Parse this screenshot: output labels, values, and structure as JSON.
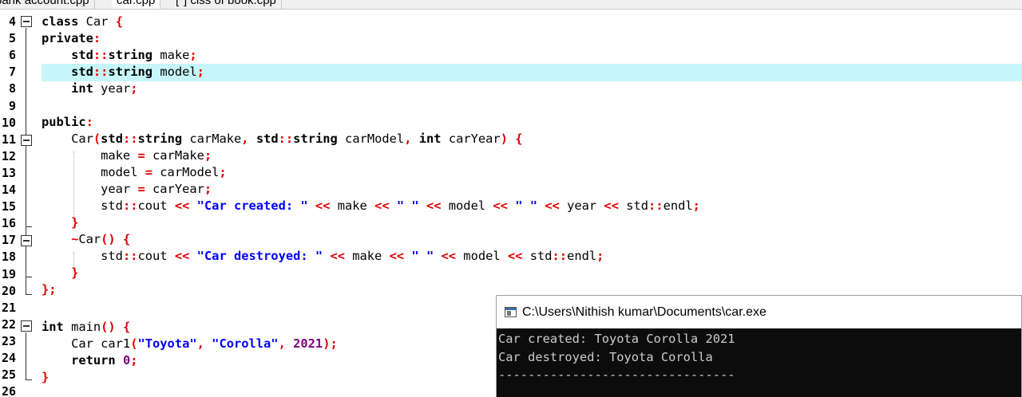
{
  "tabs": [
    "bank account.cpp",
    "car.cpp",
    "[*] clss of book.cpp"
  ],
  "line_numbers": [
    "4",
    "5",
    "6",
    "7",
    "8",
    "9",
    "10",
    "11",
    "12",
    "13",
    "14",
    "15",
    "16",
    "17",
    "18",
    "19",
    "20",
    "21",
    "22",
    "23",
    "24",
    "25",
    "26"
  ],
  "code": {
    "l4_kw": "class",
    "l4_id": " Car ",
    "l4_sy": "{",
    "l5_kw": "private",
    "l5_sy": ":",
    "l6_pre": "    ",
    "l6_a": "std",
    "l6_b": "::",
    "l6_c": "string",
    "l6_d": " make",
    "l6_e": ";",
    "l7_pre": "    ",
    "l7_a": "std",
    "l7_b": "::",
    "l7_c": "string",
    "l7_d": " model",
    "l7_e": ";",
    "l8_pre": "    ",
    "l8_kw": "int",
    "l8_id": " year",
    "l8_sy": ";",
    "l10_kw": "public",
    "l10_sy": ":",
    "l11_a": "    Car",
    "l11_b": "(",
    "l11_c": "std",
    "l11_d": "::",
    "l11_e": "string",
    "l11_f": " carMake",
    "l11_g": ", ",
    "l11_h": "std",
    "l11_i": "::",
    "l11_j": "string",
    "l11_k": " carModel",
    "l11_l": ", ",
    "l11_m": "int",
    "l11_n": " carYear",
    "l11_o": ") {",
    "l12_a": "        make ",
    "l12_b": "=",
    "l12_c": " carMake",
    "l12_d": ";",
    "l13_a": "        model ",
    "l13_b": "=",
    "l13_c": " carModel",
    "l13_d": ";",
    "l14_a": "        year ",
    "l14_b": "=",
    "l14_c": " carYear",
    "l14_d": ";",
    "l15_a": "        std",
    "l15_b": "::",
    "l15_c": "cout ",
    "l15_d": "<<",
    "l15_e": " \"Car created: \" ",
    "l15_f": "<<",
    "l15_g": " make ",
    "l15_h": "<<",
    "l15_i": " \" \" ",
    "l15_j": "<<",
    "l15_k": " model ",
    "l15_l": "<<",
    "l15_m": " \" \" ",
    "l15_n": "<<",
    "l15_o": " year ",
    "l15_p": "<<",
    "l15_q": " std",
    "l15_r": "::",
    "l15_s": "endl",
    "l15_t": ";",
    "l16": "    }",
    "l17_a": "    ~",
    "l17_b": "Car",
    "l17_c": "() {",
    "l18_a": "        std",
    "l18_b": "::",
    "l18_c": "cout ",
    "l18_d": "<<",
    "l18_e": " \"Car destroyed: \" ",
    "l18_f": "<<",
    "l18_g": " make ",
    "l18_h": "<<",
    "l18_i": " \" \" ",
    "l18_j": "<<",
    "l18_k": " model ",
    "l18_l": "<<",
    "l18_m": " std",
    "l18_n": "::",
    "l18_o": "endl",
    "l18_p": ";",
    "l19": "    }",
    "l20": "};",
    "l22_kw": "int",
    "l22_a": " main",
    "l22_b": "() {",
    "l23_a": "    Car car1",
    "l23_b": "(",
    "l23_c": "\"Toyota\"",
    "l23_d": ", ",
    "l23_e": "\"Corolla\"",
    "l23_f": ", ",
    "l23_g": "2021",
    "l23_h": ");",
    "l24_kw": "    return",
    "l24_a": " ",
    "l24_b": "0",
    "l24_c": ";",
    "l25": "}"
  },
  "console": {
    "title": "C:\\Users\\Nithish kumar\\Documents\\car.exe",
    "output": [
      "Car created: Toyota Corolla 2021",
      "Car destroyed: Toyota Corolla",
      "",
      "--------------------------------"
    ]
  },
  "colors": {
    "current_line": "#c6f6f9",
    "symbol": "#e00000",
    "string": "#0000ff",
    "number": "#800080",
    "console_bg": "#0c0c0c"
  }
}
